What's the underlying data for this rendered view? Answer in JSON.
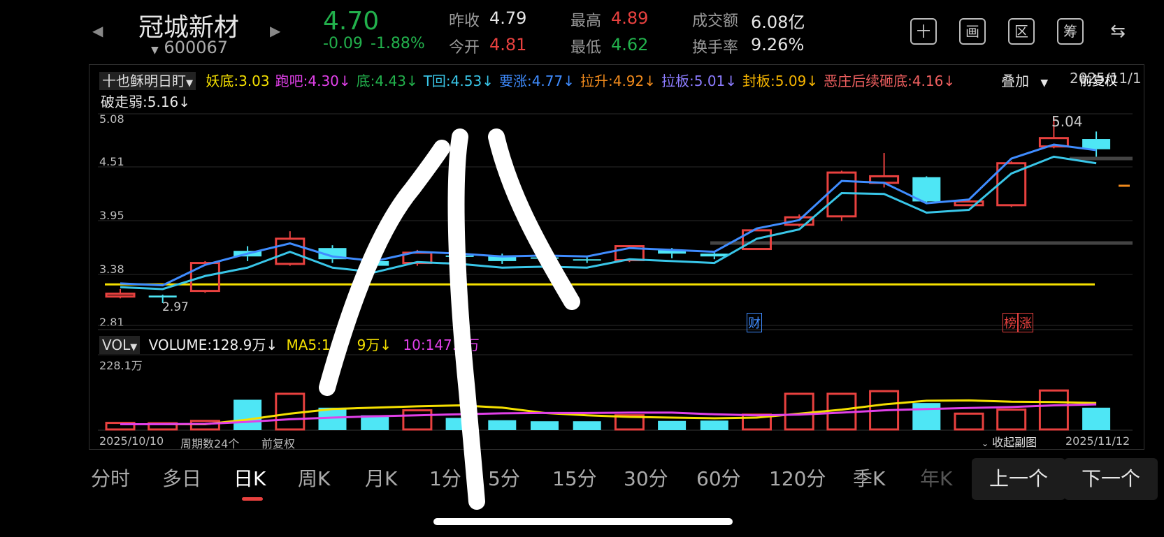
{
  "header": {
    "name": "冠城新材",
    "code": "600067",
    "price": "4.70",
    "change": "-0.09",
    "change_pct": "-1.88%",
    "prev_close_label": "昨收",
    "prev_close": "4.79",
    "open_label": "今开",
    "open": "4.81",
    "high_label": "最高",
    "high": "4.89",
    "low_label": "最低",
    "low": "4.62",
    "amount_label": "成交额",
    "amount": "6.08亿",
    "turnover_label": "换手率",
    "turnover": "9.26%",
    "tools": [
      "十",
      "画",
      "区",
      "筹",
      "⇆"
    ]
  },
  "indicators": {
    "selector": "十也稣明日盯",
    "items": [
      {
        "label": "妖底:3.03",
        "color": "#f5e000"
      },
      {
        "label": "跑吧:4.30↓",
        "color": "#e040e8"
      },
      {
        "label": "底:4.43↓",
        "color": "#22b14c"
      },
      {
        "label": "T回:4.53↓",
        "color": "#39c6e8"
      },
      {
        "label": "要涨:4.77↓",
        "color": "#3f8cff"
      },
      {
        "label": "拉升:4.92↓",
        "color": "#f08a1c"
      },
      {
        "label": "拉板:5.01↓",
        "color": "#8c7cff"
      },
      {
        "label": "封板:5.09↓",
        "color": "#f5b400"
      },
      {
        "label": "恶庄后续砸底:4.16↓",
        "color": "#f06060"
      }
    ],
    "line2": "破走弱:5.16↓",
    "overlay": "叠加",
    "adjust": "前复权",
    "adjust_partial": "2025/11/1"
  },
  "price_axis": [
    "5.08",
    "4.51",
    "3.95",
    "3.38",
    "2.81"
  ],
  "annotations": {
    "high_mark": "5.04",
    "low_mark": "2.97",
    "cai": "财",
    "bang": "榜",
    "zhang": "涨"
  },
  "volume": {
    "selector": "VOL",
    "volume_label": "VOLUME:128.9万↓",
    "ma5_label": "MA5:1",
    "ma5_label_tail": "9万↓",
    "ma10_label": "10:147.4万",
    "axis_top": "228.1万"
  },
  "footer": {
    "start_date": "2025/10/10",
    "period": "周期数24个",
    "adjust": "前复权",
    "collapse": "收起副图",
    "end_date": "2025/11/12"
  },
  "tabs": [
    "分时",
    "多日",
    "日K",
    "周K",
    "月K",
    "1分",
    "5分",
    "15分",
    "30分",
    "60分",
    "120分",
    "季K",
    "年K"
  ],
  "active_tab": "日K",
  "prev_button": "上一个",
  "next_button": "下一个",
  "chart_data": {
    "type": "candlestick",
    "y_range": [
      2.81,
      5.08
    ],
    "candles": [
      {
        "o": 3.12,
        "c": 3.15,
        "h": 3.2,
        "l": 3.1
      },
      {
        "o": 3.13,
        "c": 3.11,
        "h": 3.14,
        "l": 3.05
      },
      {
        "o": 3.18,
        "c": 3.48,
        "h": 3.5,
        "l": 3.16
      },
      {
        "o": 3.61,
        "c": 3.55,
        "h": 3.66,
        "l": 3.5
      },
      {
        "o": 3.47,
        "c": 3.74,
        "h": 3.82,
        "l": 3.45
      },
      {
        "o": 3.64,
        "c": 3.52,
        "h": 3.67,
        "l": 3.48
      },
      {
        "o": 3.5,
        "c": 3.45,
        "h": 3.53,
        "l": 3.42
      },
      {
        "o": 3.48,
        "c": 3.59,
        "h": 3.62,
        "l": 3.45
      },
      {
        "o": 3.56,
        "c": 3.55,
        "h": 3.58,
        "l": 3.52
      },
      {
        "o": 3.56,
        "c": 3.5,
        "h": 3.58,
        "l": 3.47
      },
      {
        "o": 3.54,
        "c": 3.53,
        "h": 3.56,
        "l": 3.51
      },
      {
        "o": 3.52,
        "c": 3.51,
        "h": 3.54,
        "l": 3.48
      },
      {
        "o": 3.51,
        "c": 3.66,
        "h": 3.67,
        "l": 3.49
      },
      {
        "o": 3.62,
        "c": 3.58,
        "h": 3.64,
        "l": 3.53
      },
      {
        "o": 3.58,
        "c": 3.55,
        "h": 3.61,
        "l": 3.52
      },
      {
        "o": 3.63,
        "c": 3.83,
        "h": 3.85,
        "l": 3.62
      },
      {
        "o": 3.89,
        "c": 3.97,
        "h": 4.0,
        "l": 3.87
      },
      {
        "o": 3.98,
        "c": 4.45,
        "h": 4.47,
        "l": 3.93
      },
      {
        "o": 4.34,
        "c": 4.41,
        "h": 4.66,
        "l": 4.29
      },
      {
        "o": 4.4,
        "c": 4.14,
        "h": 4.41,
        "l": 4.11
      },
      {
        "o": 4.1,
        "c": 4.14,
        "h": 4.16,
        "l": 4.1
      },
      {
        "o": 4.1,
        "c": 4.55,
        "h": 4.57,
        "l": 4.08
      },
      {
        "o": 4.73,
        "c": 4.82,
        "h": 5.04,
        "l": 4.71
      },
      {
        "o": 4.81,
        "c": 4.7,
        "h": 4.89,
        "l": 4.62
      }
    ],
    "ma_blue": [
      3.26,
      3.24,
      3.46,
      3.58,
      3.69,
      3.55,
      3.5,
      3.6,
      3.58,
      3.55,
      3.56,
      3.55,
      3.64,
      3.62,
      3.6,
      3.85,
      3.94,
      4.36,
      4.34,
      4.12,
      4.16,
      4.6,
      4.75,
      4.69
    ],
    "ma_cyan": [
      3.22,
      3.2,
      3.34,
      3.43,
      3.6,
      3.43,
      3.38,
      3.49,
      3.47,
      3.43,
      3.44,
      3.43,
      3.52,
      3.5,
      3.48,
      3.74,
      3.84,
      4.23,
      4.22,
      4.02,
      4.05,
      4.44,
      4.62,
      4.55
    ],
    "support_line": 3.25,
    "volume_max": 228.1,
    "volumes": [
      22,
      21,
      28,
      92,
      110,
      68,
      45,
      60,
      37,
      30,
      27,
      27,
      45,
      28,
      29,
      47,
      110,
      110,
      118,
      82,
      50,
      62,
      120,
      68
    ],
    "vol_up": [
      false,
      false,
      false,
      true,
      false,
      true,
      true,
      false,
      true,
      true,
      true,
      true,
      false,
      true,
      true,
      false,
      false,
      false,
      false,
      true,
      false,
      false,
      false,
      true
    ],
    "ma5_vol": [
      18,
      18,
      18,
      32,
      50,
      64,
      68,
      72,
      75,
      68,
      52,
      45,
      40,
      38,
      36,
      38,
      50,
      62,
      78,
      89,
      90,
      86,
      85,
      82
    ],
    "ma10_vol": [
      18,
      18,
      19,
      25,
      33,
      38,
      42,
      45,
      48,
      51,
      52,
      52,
      53,
      53,
      48,
      45,
      47,
      53,
      60,
      64,
      67,
      70,
      75,
      78
    ]
  }
}
